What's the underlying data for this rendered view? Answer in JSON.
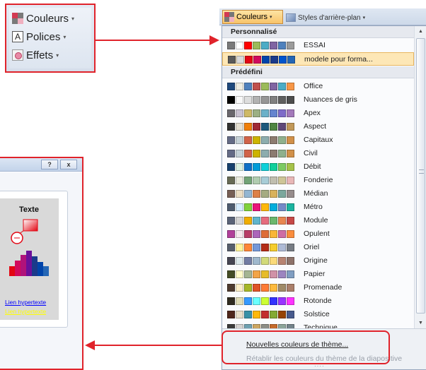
{
  "ribbon_callout": {
    "items": [
      {
        "label": "Couleurs",
        "icon": "color-palette-icon"
      },
      {
        "label": "Polices",
        "icon": "font-icon",
        "glyph": "A"
      },
      {
        "label": "Effets",
        "icon": "effects-icon"
      }
    ],
    "arrow_glyph": "▾"
  },
  "ribbon_header": {
    "colors_button_label": "Couleurs",
    "bg_styles_label": "Styles d'arrière-plan",
    "arrow_glyph": "▾"
  },
  "custom_section": {
    "title": "Personnalisé",
    "themes": [
      {
        "name": "ESSAI",
        "colors": [
          "#7a7a7a",
          "#ffffff",
          "#ff0000",
          "#9bbb59",
          "#4bacc6",
          "#8064a2",
          "#4f81bd",
          "#9b9b9b"
        ]
      },
      {
        "name": "modele pour forma...",
        "colors": [
          "#5a5a5a",
          "#d9d9d9",
          "#e30613",
          "#d10a5c",
          "#0044aa",
          "#1a3a8a",
          "#0055cc",
          "#2466b5"
        ],
        "selected": true
      }
    ]
  },
  "preset_section": {
    "title": "Prédéfini",
    "themes": [
      {
        "name": "Office",
        "colors": [
          "#1f497d",
          "#eeece1",
          "#4f81bd",
          "#c0504d",
          "#9bbb59",
          "#8064a2",
          "#4bacc6",
          "#f79646"
        ]
      },
      {
        "name": "Nuances de gris",
        "colors": [
          "#000000",
          "#f8f8f8",
          "#dddddd",
          "#b2b2b2",
          "#969696",
          "#808080",
          "#5f5f5f",
          "#4d4d4d"
        ]
      },
      {
        "name": "Apex",
        "colors": [
          "#69676d",
          "#c9c2d1",
          "#ceb966",
          "#9cb084",
          "#6bb1c9",
          "#6585cf",
          "#7e6bc9",
          "#a379bb"
        ]
      },
      {
        "name": "Aspect",
        "colors": [
          "#323232",
          "#e3ded1",
          "#f07f09",
          "#9f2936",
          "#1b587c",
          "#4e8542",
          "#604878",
          "#c19859"
        ]
      },
      {
        "name": "Capitaux",
        "colors": [
          "#646b86",
          "#c5d1d7",
          "#d16349",
          "#ccb400",
          "#8cadae",
          "#8c7b70",
          "#8fb08c",
          "#d19049"
        ]
      },
      {
        "name": "Civil",
        "colors": [
          "#646b86",
          "#c5d1d7",
          "#d16349",
          "#ccb400",
          "#8cadae",
          "#8c7b70",
          "#8fb08c",
          "#d19049"
        ]
      },
      {
        "name": "Débit",
        "colors": [
          "#17406d",
          "#dbefe0",
          "#0f6fc6",
          "#009dd9",
          "#0bd0d9",
          "#10cf9b",
          "#7cca62",
          "#a5c249"
        ]
      },
      {
        "name": "Fonderie",
        "colors": [
          "#676a55",
          "#eaebde",
          "#72a376",
          "#b0ccb0",
          "#a8cdd7",
          "#c0beaf",
          "#cec597",
          "#e8b7b7"
        ]
      },
      {
        "name": "Médian",
        "colors": [
          "#775f55",
          "#ebddc3",
          "#94b6d2",
          "#dd8047",
          "#a5ab81",
          "#d8b25c",
          "#7ba79d",
          "#968c8c"
        ]
      },
      {
        "name": "Métro",
        "colors": [
          "#4e5b6f",
          "#d6ecff",
          "#7fd13b",
          "#ea157a",
          "#feb80a",
          "#00addc",
          "#738ac8",
          "#1ab39f"
        ]
      },
      {
        "name": "Module",
        "colors": [
          "#5a6378",
          "#d4d4d4",
          "#f0ad00",
          "#60b5cc",
          "#e66c7d",
          "#6bb76d",
          "#e88651",
          "#c64847"
        ]
      },
      {
        "name": "Opulent",
        "colors": [
          "#b13f9a",
          "#f4e7ed",
          "#b83d68",
          "#ac66bb",
          "#de6c36",
          "#f9b639",
          "#cf6da4",
          "#fa8d3d"
        ]
      },
      {
        "name": "Oriel",
        "colors": [
          "#575f6d",
          "#fff39d",
          "#fe8637",
          "#7598d9",
          "#b32c16",
          "#f5cd2d",
          "#aebad5",
          "#777c84"
        ]
      },
      {
        "name": "Origine",
        "colors": [
          "#464653",
          "#dde9ec",
          "#727ca3",
          "#9fb8cd",
          "#d2da7a",
          "#fada7a",
          "#b88472",
          "#8e736a"
        ]
      },
      {
        "name": "Papier",
        "colors": [
          "#444d26",
          "#fefac9",
          "#a5b592",
          "#f3a447",
          "#e7bc29",
          "#d092a7",
          "#9c85c0",
          "#809ec2"
        ]
      },
      {
        "name": "Promenade",
        "colors": [
          "#4e3b30",
          "#fbeec9",
          "#a6b727",
          "#df5327",
          "#fe7a35",
          "#fdba3d",
          "#9f8a68",
          "#aa7f6b"
        ]
      },
      {
        "name": "Rotonde",
        "colors": [
          "#2f2b20",
          "#dfdcb7",
          "#3399ff",
          "#69ffff",
          "#ccff33",
          "#3333ff",
          "#9933ff",
          "#ff33ff"
        ]
      },
      {
        "name": "Solstice",
        "colors": [
          "#4f271c",
          "#e7dec9",
          "#3891a7",
          "#feb80a",
          "#c32d2e",
          "#84aa33",
          "#964305",
          "#475a8d"
        ]
      },
      {
        "name": "Technique",
        "colors": [
          "#3b3b3b",
          "#d4d2d0",
          "#6ea0b0",
          "#cca661",
          "#8c8d86",
          "#c46a2b",
          "#8ca59a",
          "#74848b"
        ]
      }
    ]
  },
  "scroll": {
    "up_glyph": "▲",
    "down_glyph": "▼"
  },
  "footer": {
    "new_colors_label": "Nouvelles couleurs de thème...",
    "reset_label": "Rétablir les couleurs du thème de la diapositive",
    "grip": "····"
  },
  "dialog": {
    "help_glyph": "?",
    "close_glyph": "x",
    "preview_title": "Texte",
    "link_label": "Lien hypertexte",
    "visited_link_label": "Lien hypertexte",
    "link_color": "#0000ff",
    "visited_link_color": "#ffff00",
    "bar_colors": [
      "#e30613",
      "#d10a5c",
      "#0044aa",
      "#1a3a8a",
      "#0055cc",
      "#2466b5"
    ]
  },
  "colors": {
    "callout_red": "#e0232b",
    "selected_row": "#fde7b6"
  }
}
